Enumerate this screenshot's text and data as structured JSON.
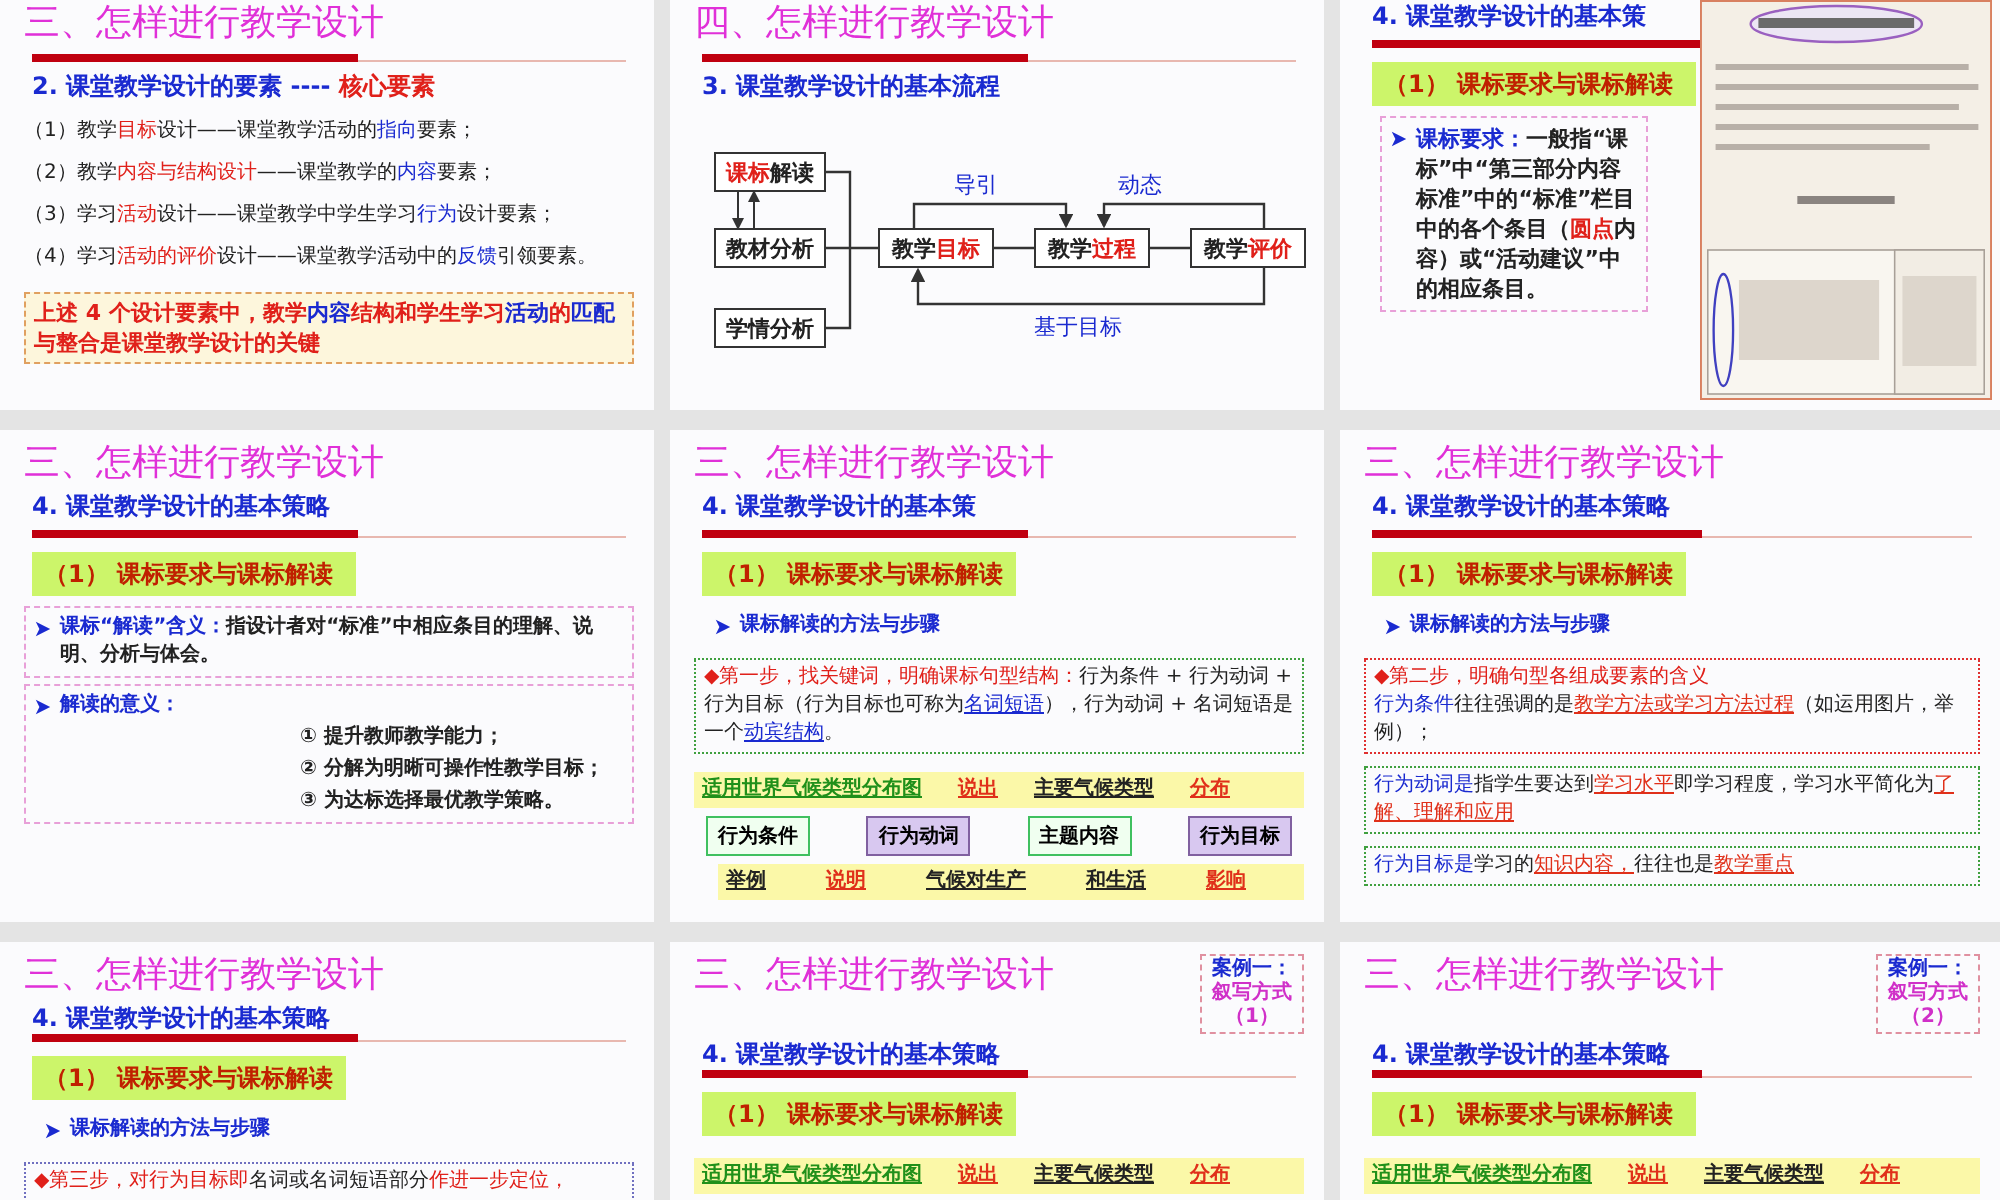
{
  "slides": [
    {
      "selected": false,
      "blocks": [
        {
          "kind": "title",
          "text": "三、怎样进行教学设计"
        },
        {
          "kind": "rule"
        },
        {
          "kind": "subtitle",
          "parts": [
            {
              "text": "2. 课堂教学设计的要素 ---- ",
              "kind": "blue"
            },
            {
              "text": "核心要素",
              "kind": "red"
            }
          ]
        },
        {
          "kind": "para",
          "parts": [
            {
              "text": "（1）教学",
              "kind": "plain"
            },
            {
              "text": "目标",
              "kind": "red"
            },
            {
              "text": "设计——课堂教学活动的",
              "kind": "plain"
            },
            {
              "text": "指向",
              "kind": "blue"
            },
            {
              "text": "要素；",
              "kind": "plain"
            }
          ]
        },
        {
          "kind": "para",
          "parts": [
            {
              "text": "（2）教学",
              "kind": "plain"
            },
            {
              "text": "内容与结构设计",
              "kind": "red"
            },
            {
              "text": "——课堂教学的",
              "kind": "plain"
            },
            {
              "text": "内容",
              "kind": "blue"
            },
            {
              "text": "要素；",
              "kind": "plain"
            }
          ]
        },
        {
          "kind": "para",
          "parts": [
            {
              "text": "（3）学习",
              "kind": "plain"
            },
            {
              "text": "活动",
              "kind": "red"
            },
            {
              "text": "设计——课堂教学中学生学习",
              "kind": "plain"
            },
            {
              "text": "行为",
              "kind": "blue"
            },
            {
              "text": "设计要素；",
              "kind": "plain"
            }
          ]
        },
        {
          "kind": "para",
          "parts": [
            {
              "text": "（4）学习",
              "kind": "plain"
            },
            {
              "text": "活动的评价",
              "kind": "red"
            },
            {
              "text": "设计——课堂教学活动中的",
              "kind": "plain"
            },
            {
              "text": "反馈",
              "kind": "blue"
            },
            {
              "text": "引领要素。",
              "kind": "plain"
            }
          ]
        },
        {
          "kind": "note",
          "parts": [
            {
              "text": "上述 4 个设计要素中，教学",
              "kind": "red"
            },
            {
              "text": "内容",
              "kind": "blue"
            },
            {
              "text": "结构和学生学习",
              "kind": "red"
            },
            {
              "text": "活动",
              "kind": "blue"
            },
            {
              "text": "的",
              "kind": "red"
            },
            {
              "text": "匹配",
              "kind": "blue"
            },
            {
              "text": "与整合是课堂教学设计的关键",
              "kind": "red"
            }
          ]
        }
      ]
    },
    {
      "selected": false,
      "blocks": [
        {
          "kind": "title",
          "text": "四、怎样进行教学设计"
        },
        {
          "kind": "rule"
        },
        {
          "kind": "subtitle",
          "parts": [
            {
              "text": "3. 课堂教学设计的基本流程",
              "kind": "blue"
            }
          ]
        },
        {
          "kind": "flow",
          "inputs": [
            [
              {
                "text": "课标",
                "kind": "red"
              },
              {
                "text": "解读",
                "kind": "plain"
              }
            ],
            [
              {
                "text": "教材分析",
                "kind": "plain"
              }
            ],
            [
              {
                "text": "学情分析",
                "kind": "plain"
              }
            ]
          ],
          "steps": [
            [
              {
                "text": "教学",
                "kind": "plain"
              },
              {
                "text": "目标",
                "kind": "red"
              }
            ],
            [
              {
                "text": "教学",
                "kind": "plain"
              },
              {
                "text": "过程",
                "kind": "red"
              }
            ],
            [
              {
                "text": "教学",
                "kind": "plain"
              },
              {
                "text": "评价",
                "kind": "red"
              }
            ]
          ],
          "labels": [
            "导引",
            "动态",
            "基于目标"
          ]
        }
      ]
    },
    {
      "selected": false,
      "blocks": [
        {
          "kind": "subtitle",
          "parts": [
            {
              "text": "4. 课堂教学设计的基本策",
              "kind": "blue"
            }
          ]
        },
        {
          "kind": "rule"
        },
        {
          "kind": "heading",
          "text": "（1） 课标要求与课标解读"
        },
        {
          "kind": "bullet",
          "color": "#e8a0d8",
          "parts": [
            {
              "text": "课标要求：",
              "kind": "blue"
            },
            {
              "text": "一般指“课标”中“第三部分内容标准”中的“标准”栏目中的各个条目（",
              "kind": "plain"
            },
            {
              "text": "圆点",
              "kind": "red"
            },
            {
              "text": "内容）或“活动建议”中的相应条目。",
              "kind": "plain"
            }
          ]
        },
        {
          "kind": "picture"
        }
      ]
    },
    {
      "selected": false,
      "blocks": [
        {
          "kind": "title",
          "text": "三、怎样进行教学设计"
        },
        {
          "kind": "subtitle",
          "parts": [
            {
              "text": "4. 课堂教学设计的基本策略",
              "kind": "blue"
            }
          ]
        },
        {
          "kind": "rule"
        },
        {
          "kind": "heading",
          "text": "（1） 课标要求与课标解读"
        },
        {
          "kind": "bullet",
          "color": "#e8a0d8",
          "parts": [
            {
              "text": "课标“解读”含义：",
              "kind": "blue"
            },
            {
              "text": "指设计者对“标准”中相应条目的理解、说明、分析与体会。",
              "kind": "plain"
            }
          ]
        },
        {
          "kind": "bullet",
          "color": "#e8a0d8",
          "parts": [
            {
              "text": "解读的意义：",
              "kind": "blue"
            }
          ],
          "items": [
            "① 提升教师教学能力；",
            "② 分解为明晰可操作性教学目标；",
            "③ 为达标选择最优教学策略。"
          ]
        }
      ]
    },
    {
      "selected": false,
      "blocks": [
        {
          "kind": "title",
          "text": "三、怎样进行教学设计"
        },
        {
          "kind": "subtitle",
          "parts": [
            {
              "text": "4. 课堂教学设计的基本策",
              "kind": "blue"
            }
          ]
        },
        {
          "kind": "rule"
        },
        {
          "kind": "heading",
          "text": "（1） 课标要求与课标解读"
        },
        {
          "kind": "bullet",
          "parts": [
            {
              "text": "课标解读的方法与步骤",
              "kind": "blue"
            }
          ]
        },
        {
          "kind": "box",
          "color": "#40a040",
          "lines": [
            [
              {
                "text": "◆第一步，找关键词，明确课标句型结构：",
                "kind": "red"
              },
              {
                "text": "行为条件 + 行为动词 + 行为目标（行为目标也可称为",
                "kind": "plain"
              },
              {
                "text": "名词短语",
                "kind": "link"
              },
              {
                "text": "），行为动词 + 名词短语是一个",
                "kind": "plain"
              },
              {
                "text": "动宾结构",
                "kind": "link"
              },
              {
                "text": "。",
                "kind": "plain"
              }
            ]
          ]
        },
        {
          "kind": "structure",
          "top": [
            {
              "text": "适用世界气候类型分布图",
              "kind": "green-underline"
            },
            {
              "text": "说出",
              "kind": "red-underline"
            },
            {
              "text": "主要气候类型",
              "kind": "black-underline"
            },
            {
              "text": "分布",
              "kind": "red-underline"
            }
          ],
          "boxes": [
            {
              "label": "行为条件",
              "kind": "condition"
            },
            {
              "label": "行为动词",
              "kind": "target"
            },
            {
              "label": "主题内容",
              "kind": "condition"
            },
            {
              "label": "行为目标",
              "kind": "target"
            }
          ],
          "bottom": [
            {
              "text": "举例",
              "kind": "black-underline"
            },
            {
              "text": "说明",
              "kind": "red-underline"
            },
            {
              "text": "气候对生产",
              "kind": "black-underline"
            },
            {
              "text": "和生活",
              "kind": "black-underline"
            },
            {
              "text": "影响",
              "kind": "red-underline"
            }
          ]
        }
      ]
    },
    {
      "selected": false,
      "blocks": [
        {
          "kind": "title",
          "text": "三、怎样进行教学设计"
        },
        {
          "kind": "subtitle",
          "parts": [
            {
              "text": "4. 课堂教学设计的基本策略",
              "kind": "blue"
            }
          ]
        },
        {
          "kind": "rule"
        },
        {
          "kind": "heading",
          "text": "（1） 课标要求与课标解读"
        },
        {
          "kind": "bullet",
          "parts": [
            {
              "text": "课标解读的方法与步骤",
              "kind": "blue"
            }
          ]
        },
        {
          "kind": "box",
          "color": "#e03030",
          "lines": [
            [
              {
                "text": "◆第二步，明确句型各组成要素的含义",
                "kind": "red"
              }
            ],
            [
              {
                "text": "行为条件",
                "kind": "blue"
              },
              {
                "text": "往往强调的是",
                "kind": "plain"
              },
              {
                "text": "教学方法或学习方法过程",
                "kind": "red-underline"
              },
              {
                "text": "（如运用图片，举例）；",
                "kind": "plain"
              }
            ]
          ]
        },
        {
          "kind": "box",
          "color": "#40a040",
          "lines": [
            [
              {
                "text": "行为动词是",
                "kind": "blue"
              },
              {
                "text": "指学生要达到",
                "kind": "plain"
              },
              {
                "text": "学习水平",
                "kind": "red-underline"
              },
              {
                "text": "即学习程度，学习水平简化为",
                "kind": "plain"
              },
              {
                "text": "了解、理解和应用",
                "kind": "red-underline"
              }
            ]
          ]
        },
        {
          "kind": "box",
          "color": "#40a040",
          "lines": [
            [
              {
                "text": "行为目标是",
                "kind": "blue"
              },
              {
                "text": "学习的",
                "kind": "plain"
              },
              {
                "text": "知识内容，",
                "kind": "red-underline"
              },
              {
                "text": "往往也是",
                "kind": "plain"
              },
              {
                "text": "教学重点",
                "kind": "red-underline"
              }
            ]
          ]
        }
      ]
    },
    {
      "selected": false,
      "blocks": [
        {
          "kind": "title",
          "text": "三、怎样进行教学设计"
        },
        {
          "kind": "subtitle",
          "parts": [
            {
              "text": "4. 课堂教学设计的基本策略",
              "kind": "blue"
            }
          ]
        },
        {
          "kind": "rule"
        },
        {
          "kind": "heading",
          "text": "（1） 课标要求与课标解读"
        },
        {
          "kind": "bullet",
          "parts": [
            {
              "text": "课标解读的方法与步骤",
              "kind": "blue"
            }
          ]
        },
        {
          "kind": "box",
          "color": "#7070c0",
          "lines": [
            [
              {
                "text": "◆第三步，对行为目标即",
                "kind": "red"
              },
              {
                "text": "名词或名词短语部分",
                "kind": "plain"
              },
              {
                "text": "作进一步定位，",
                "kind": "red"
              }
            ]
          ]
        }
      ]
    },
    {
      "selected": false,
      "blocks": [
        {
          "kind": "title",
          "text": "三、怎样进行教学设计"
        },
        {
          "kind": "case",
          "parts": [
            {
              "text": "案例一：",
              "kind": "blue"
            },
            {
              "text": "叙写方式",
              "kind": "magenta"
            },
            {
              "text": "（1）",
              "kind": "magenta"
            }
          ]
        },
        {
          "kind": "subtitle",
          "parts": [
            {
              "text": "4. 课堂教学设计的基本策略",
              "kind": "blue"
            }
          ]
        },
        {
          "kind": "rule"
        },
        {
          "kind": "heading",
          "text": "（1） 课标要求与课标解读"
        },
        {
          "kind": "structure",
          "top": [
            {
              "text": "适用世界气候类型分布图",
              "kind": "green-underline"
            },
            {
              "text": "说出",
              "kind": "red-underline"
            },
            {
              "text": "主要气候类型",
              "kind": "black-underline"
            },
            {
              "text": "分布",
              "kind": "red-underline"
            }
          ]
        }
      ]
    },
    {
      "selected": false,
      "blocks": [
        {
          "kind": "title",
          "text": "三、怎样进行教学设计"
        },
        {
          "kind": "case",
          "parts": [
            {
              "text": "案例一：",
              "kind": "blue"
            },
            {
              "text": "叙写方式",
              "kind": "magenta"
            },
            {
              "text": "（2）",
              "kind": "magenta"
            }
          ]
        },
        {
          "kind": "subtitle",
          "parts": [
            {
              "text": "4. 课堂教学设计的基本策略",
              "kind": "blue"
            }
          ]
        },
        {
          "kind": "rule"
        },
        {
          "kind": "heading",
          "text": "（1） 课标要求与课标解读"
        },
        {
          "kind": "structure",
          "top": [
            {
              "text": "适用世界气候类型分布图",
              "kind": "green-underline"
            },
            {
              "text": "说出",
              "kind": "red-underline"
            },
            {
              "text": "主要气候类型",
              "kind": "black-underline"
            },
            {
              "text": "分布",
              "kind": "red-underline"
            }
          ]
        }
      ]
    }
  ]
}
